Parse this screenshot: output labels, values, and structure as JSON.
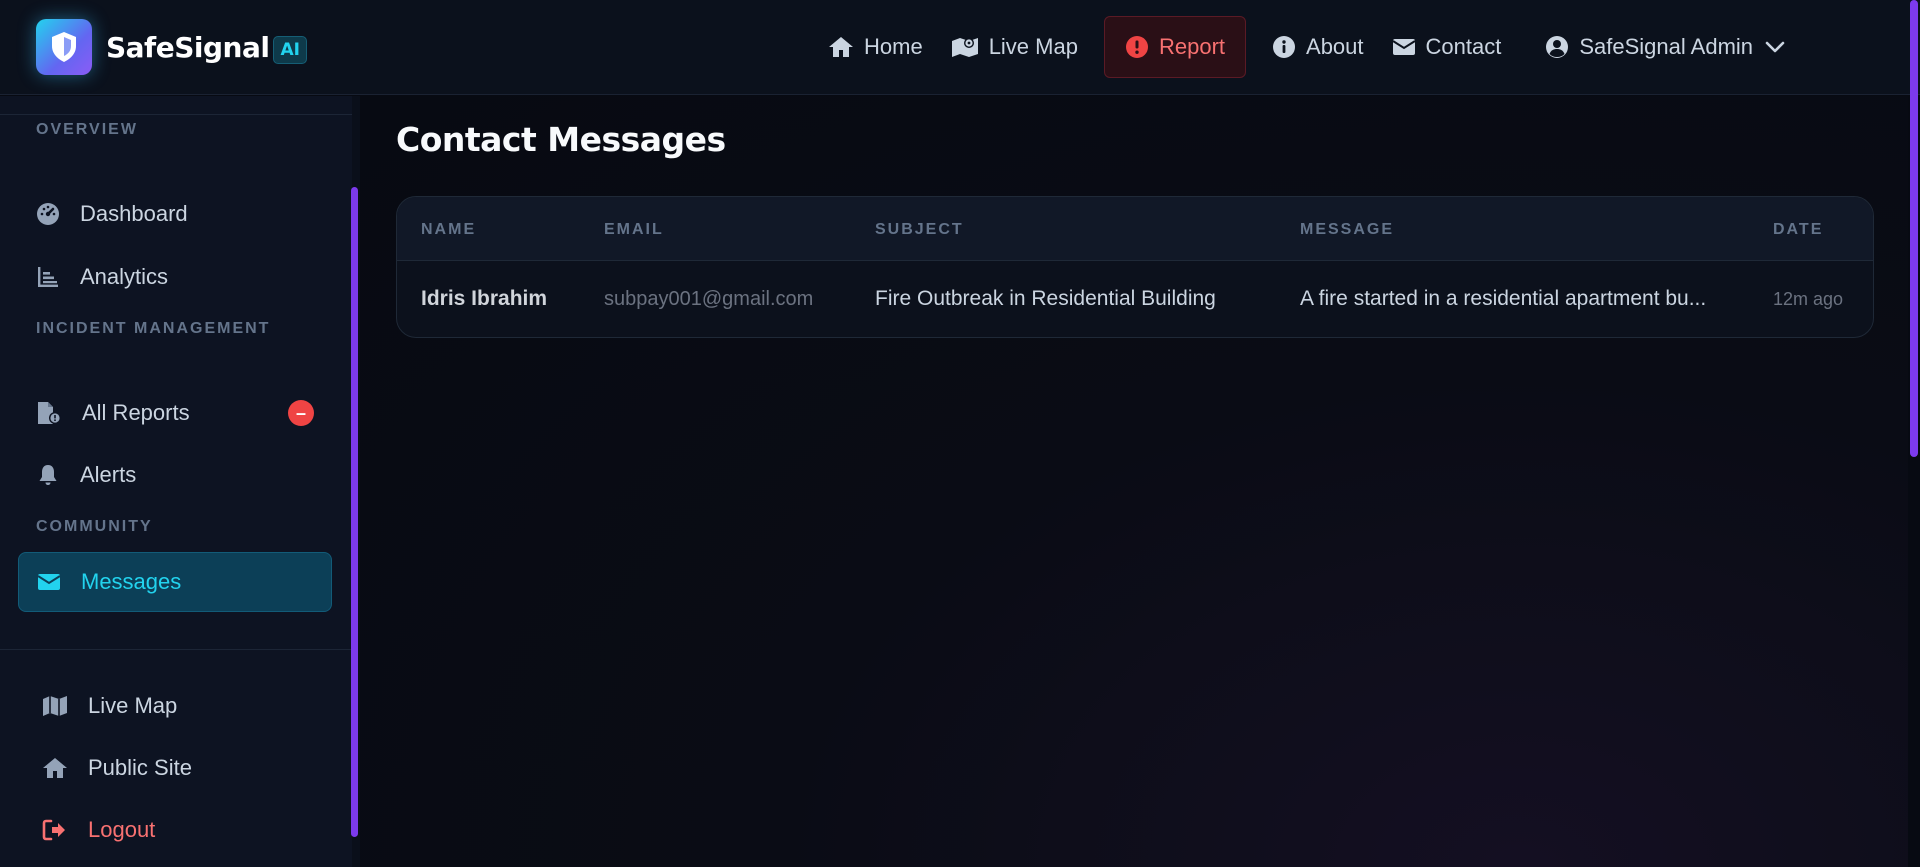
{
  "brand": {
    "name": "SafeSignal",
    "badge": "AI",
    "logo_icon": "shield-icon",
    "accent": "#22d3ee"
  },
  "nav": {
    "items": [
      {
        "label": "Home",
        "icon": "home-icon"
      },
      {
        "label": "Live Map",
        "icon": "map-icon"
      },
      {
        "label": "Report",
        "icon": "alert-circle-icon",
        "color": "#f87171"
      },
      {
        "label": "About",
        "icon": "info-icon"
      },
      {
        "label": "Contact",
        "icon": "envelope-icon"
      }
    ],
    "user": {
      "label": "SafeSignal Admin",
      "icon": "user-circle-icon"
    }
  },
  "sidebar": {
    "sections": [
      {
        "label": "OVERVIEW"
      },
      {
        "label": "INCIDENT MANAGEMENT"
      },
      {
        "label": "COMMUNITY"
      }
    ],
    "items": [
      {
        "label": "Dashboard",
        "icon": "gauge-icon"
      },
      {
        "label": "Analytics",
        "icon": "bar-chart-icon"
      },
      {
        "label": "All Reports",
        "icon": "file-report-icon",
        "badge": "–",
        "badge_color": "#ef4444"
      },
      {
        "label": "Alerts",
        "icon": "bell-icon"
      },
      {
        "label": "Messages",
        "icon": "envelope-icon",
        "active": true
      }
    ],
    "footer": [
      {
        "label": "Live Map",
        "icon": "map-icon"
      },
      {
        "label": "Public Site",
        "icon": "home-icon"
      },
      {
        "label": "Logout",
        "icon": "logout-icon",
        "color": "#f87171"
      }
    ]
  },
  "main": {
    "title": "Contact Messages",
    "table": {
      "columns": [
        "NAME",
        "EMAIL",
        "SUBJECT",
        "MESSAGE",
        "DATE"
      ],
      "rows": [
        {
          "name": "Idris Ibrahim",
          "email": "subpay001@gmail.com",
          "subject": "Fire Outbreak in Residential Building",
          "message": "A fire started in a residential apartment bu...",
          "date": "12m ago"
        }
      ]
    }
  }
}
